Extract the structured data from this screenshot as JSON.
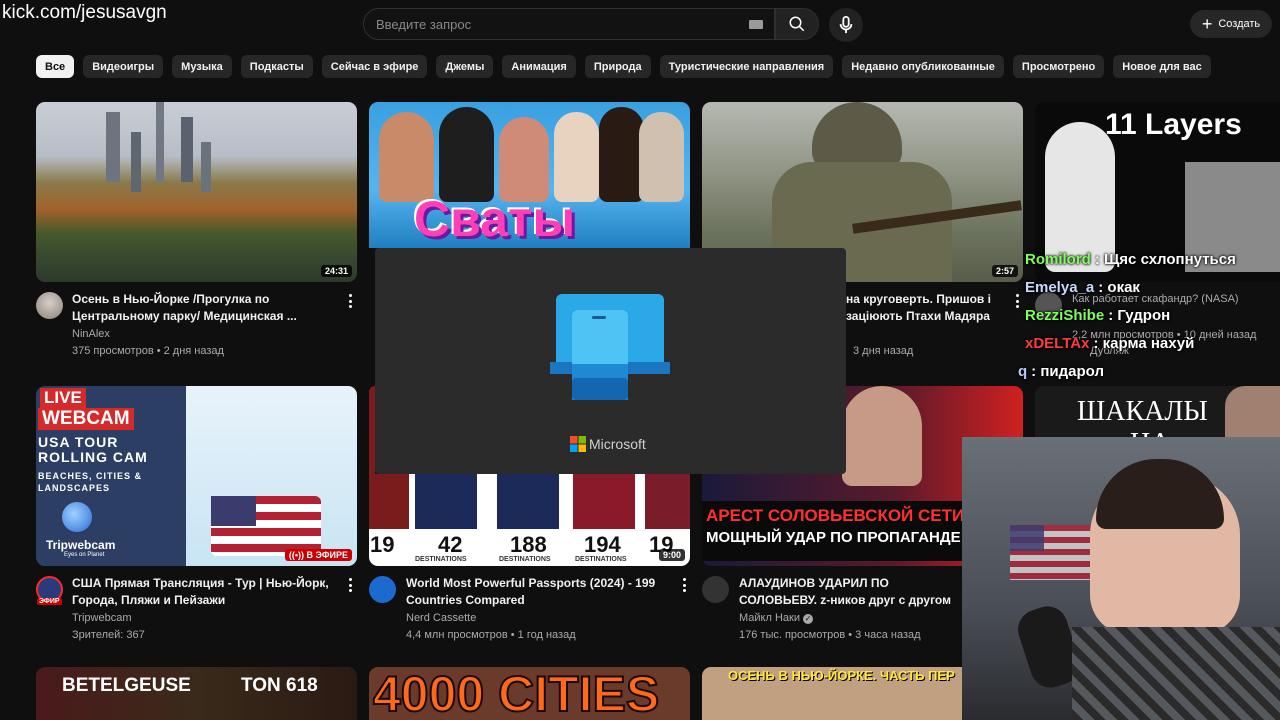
{
  "stream_url": "kick.com/jesusavgn",
  "search": {
    "placeholder": "Введите запрос"
  },
  "create_label": "Создать",
  "chips": [
    "Все",
    "Видеоигры",
    "Музыка",
    "Подкасты",
    "Сейчас в эфире",
    "Джемы",
    "Анимация",
    "Природа",
    "Туристические направления",
    "Недавно опубликованные",
    "Просмотрено",
    "Новое для вас"
  ],
  "videos": [
    {
      "title": "Осень в Нью-Йорке /Прогулка по Центральному парку/ Медицинская ...",
      "channel": "NinAlex",
      "meta": "375 просмотров • 2 дня назад",
      "duration": "24:31"
    },
    {
      "thumb_text": "Сваты"
    },
    {
      "title": "на круговерть. Пришов і заціюють Птахи Мадяра",
      "meta": "3 дня назад",
      "duration": "2:57"
    },
    {
      "thumb_text": "11 Layers",
      "title": "Как работает скафандр? (NASA)",
      "meta": "2,2 млн просмотров • 10 дней назад",
      "channel": "Дубляж"
    },
    {
      "title": "США Прямая Трансляция - Тур | Нью-Йорк, Города, Пляжи и Пейзажи",
      "channel": "Tripwebcam",
      "meta": "Зрителей: 367",
      "live_badge": "В ЭФИРЕ",
      "avatar_badge": "ЭФИР",
      "thumb_lines": [
        "LIVE",
        "WEBCAM",
        "USA TOUR",
        "ROLLING CAM",
        "BEACHES, CITIES &",
        "LANDSCAPES"
      ],
      "brand": "Tripwebcam",
      "brand_sub": "Eyes on Planet"
    },
    {
      "title": "World Most Powerful Passports (2024) - 199 Countries Compared",
      "channel": "Nerd Cassette",
      "meta": "4,4 млн просмотров • 1 год назад",
      "duration": "9:00",
      "numbers": [
        "19",
        "42",
        "188",
        "194",
        "19"
      ],
      "destinations": "DESTINATIONS"
    },
    {
      "title": "АЛАУДИНОВ УДАРИЛ ПО СОЛОВЬЕВУ. z-ников друг с другом НАБИРАЕТ ОБОР",
      "channel": "Майкл Наки",
      "meta": "176 тыс. просмотров • 3 часа назад",
      "thumb_lines": [
        "АРЕСТ СОЛОВЬЕВСКОЙ СЕТИ",
        "МОЩНЫЙ УДАР ПО ПРОПАГАНДЕ"
      ]
    },
    {
      "thumb_lines": [
        "ШАКАЛЫ",
        "НА"
      ]
    },
    {
      "thumb_lines": [
        "BETELGEUSE",
        "TON 618"
      ]
    },
    {
      "thumb_text": "4000 CITIES"
    },
    {
      "thumb_text": "ОСЕНЬ В НЬЮ-ЙОРКЕ. ЧАСТЬ ПЕР"
    }
  ],
  "splash": {
    "brand": "Microsoft"
  },
  "chat": [
    {
      "user": "Romilord",
      "color": "#7dff5b",
      "text": "Щяс схлопнуться"
    },
    {
      "user": "Emelya_a",
      "color": "#c9d8ff",
      "text": "окак"
    },
    {
      "user": "RezziShibe",
      "color": "#7dff5b",
      "text": "Гудрон"
    },
    {
      "user": "xDELTAx",
      "color": "#ff3b3b",
      "text": "карма нахуй"
    },
    {
      "user": "q",
      "color": "#b8c8ff",
      "text": "пидарол"
    }
  ]
}
